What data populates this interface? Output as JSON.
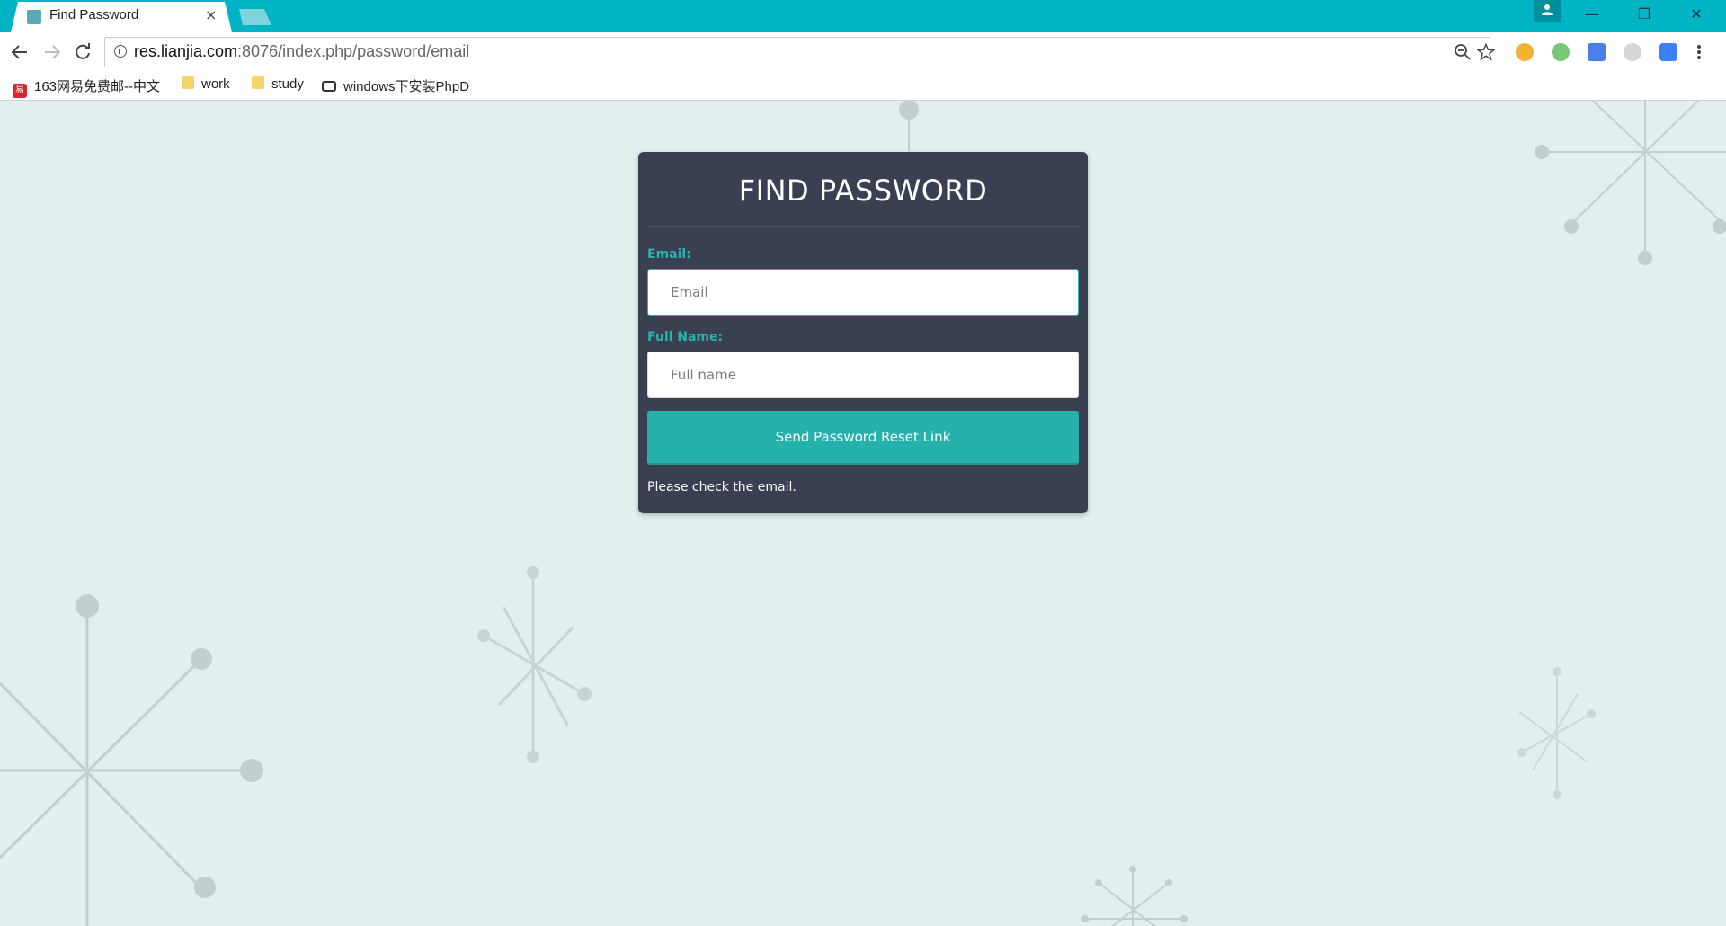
{
  "browser": {
    "tab_title": "Find Password",
    "tab_close": "×",
    "url_host": "res.lianjia.com",
    "url_path": ":8076/index.php/password/email",
    "window_controls": {
      "minimize": "—",
      "restore": "❐",
      "close": "✕"
    },
    "bookmarks": [
      {
        "label": "163网易免费邮--中文",
        "icon": "163-icon"
      },
      {
        "label": "work",
        "icon": "folder-icon"
      },
      {
        "label": "study",
        "icon": "folder-icon"
      },
      {
        "label": "windows下安装PhpD",
        "icon": "link-icon"
      }
    ],
    "extension_colors": [
      "#f2b233",
      "#7cc576",
      "#4a7ee8",
      "#bdbdbd",
      "#3b82f6"
    ]
  },
  "form": {
    "title": "FIND PASSWORD",
    "email_label": "Email:",
    "email_placeholder": "Email",
    "email_value": "",
    "fullname_label": "Full Name:",
    "fullname_placeholder": "Full name",
    "fullname_value": "",
    "submit_label": "Send Password Reset Link",
    "status_message": "Please check the email."
  },
  "colors": {
    "chrome_accent": "#00b4c6",
    "page_background": "#e1f0ef",
    "card_background": "#3b3f52",
    "label_accent": "#2ab3ae",
    "button_background": "#25b2ad",
    "decoration": "#c2cdcd"
  }
}
